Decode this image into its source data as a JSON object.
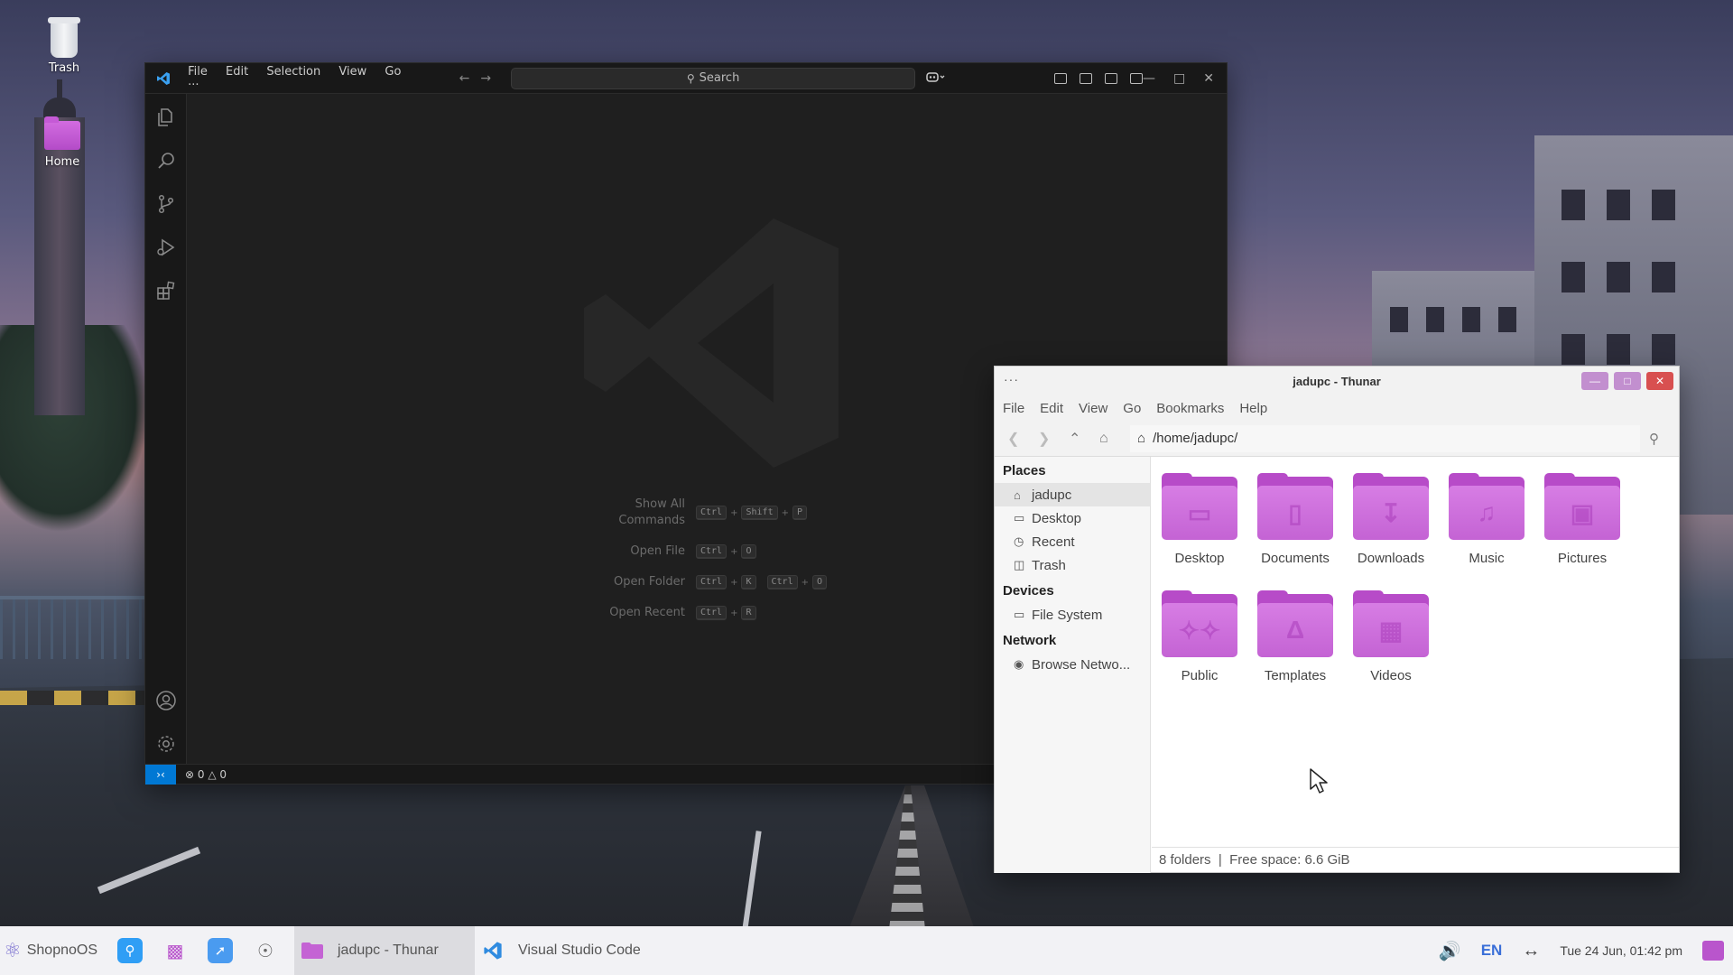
{
  "desktop": {
    "icons": [
      {
        "label": "Trash"
      },
      {
        "label": "Home"
      }
    ]
  },
  "vscode": {
    "menu": [
      "File",
      "Edit",
      "Selection",
      "View",
      "Go",
      "···"
    ],
    "search_label": "Search",
    "shortcuts": [
      {
        "label": "Show All Commands",
        "keys": [
          [
            "Ctrl",
            "Shift",
            "P"
          ]
        ]
      },
      {
        "label": "Open File",
        "keys": [
          [
            "Ctrl",
            "O"
          ]
        ]
      },
      {
        "label": "Open Folder",
        "keys": [
          [
            "Ctrl",
            "K"
          ],
          [
            "Ctrl",
            "O"
          ]
        ]
      },
      {
        "label": "Open Recent",
        "keys": [
          [
            "Ctrl",
            "R"
          ]
        ]
      }
    ],
    "status": {
      "errors": "0",
      "warnings": "0"
    },
    "accent": "#0078d4"
  },
  "thunar": {
    "title": "jadupc - Thunar",
    "menu": [
      "File",
      "Edit",
      "View",
      "Go",
      "Bookmarks",
      "Help"
    ],
    "path": "/home/jadupc/",
    "sidebar": {
      "places_heading": "Places",
      "places": [
        {
          "label": "jadupc",
          "icon": "home-icon",
          "active": true
        },
        {
          "label": "Desktop",
          "icon": "desktop-icon"
        },
        {
          "label": "Recent",
          "icon": "clock-icon"
        },
        {
          "label": "Trash",
          "icon": "trash-icon"
        }
      ],
      "devices_heading": "Devices",
      "devices": [
        {
          "label": "File System",
          "icon": "drive-icon"
        }
      ],
      "network_heading": "Network",
      "network": [
        {
          "label": "Browse Netwo...",
          "icon": "network-icon"
        }
      ]
    },
    "folders": [
      {
        "label": "Desktop",
        "icon": "monitor-icon"
      },
      {
        "label": "Documents",
        "icon": "document-icon"
      },
      {
        "label": "Downloads",
        "icon": "download-icon"
      },
      {
        "label": "Music",
        "icon": "music-icon"
      },
      {
        "label": "Pictures",
        "icon": "picture-icon"
      },
      {
        "label": "Public",
        "icon": "people-icon"
      },
      {
        "label": "Templates",
        "icon": "template-icon"
      },
      {
        "label": "Videos",
        "icon": "film-icon"
      }
    ],
    "status": "8 folders  |  Free space: 6.6 GiB",
    "folder_color": "#c463d4"
  },
  "taskbar": {
    "start_label": "ShopnoOS",
    "tasks": [
      {
        "label": "jadupc - Thunar",
        "active": true
      },
      {
        "label": "Visual Studio Code",
        "active": false
      }
    ],
    "lang": "EN",
    "clock": "Tue 24 Jun, 01:42 pm"
  }
}
